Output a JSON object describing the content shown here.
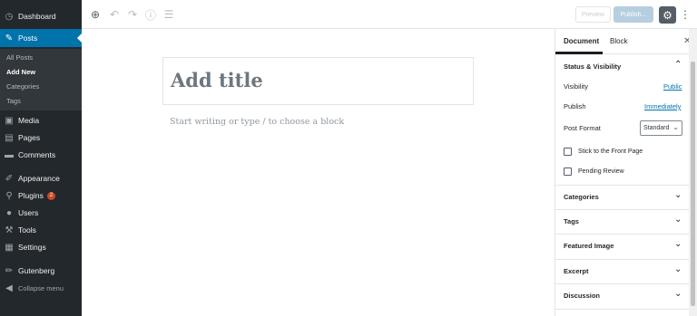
{
  "admin_menu": {
    "items": [
      {
        "label": "Dashboard",
        "icon": "dashboard-icon",
        "glyph": "◷"
      },
      {
        "label": "Posts",
        "icon": "pin-icon",
        "glyph": "✎"
      },
      {
        "label": "Media",
        "icon": "media-icon",
        "glyph": "▣"
      },
      {
        "label": "Pages",
        "icon": "pages-icon",
        "glyph": "▤"
      },
      {
        "label": "Comments",
        "icon": "comments-icon",
        "glyph": "▬"
      },
      {
        "label": "Appearance",
        "icon": "brush-icon",
        "glyph": "✐"
      },
      {
        "label": "Plugins",
        "icon": "plugin-icon",
        "glyph": "⚲",
        "badge": "2"
      },
      {
        "label": "Users",
        "icon": "users-icon",
        "glyph": "●"
      },
      {
        "label": "Tools",
        "icon": "wrench-icon",
        "glyph": "⚒"
      },
      {
        "label": "Settings",
        "icon": "settings-icon",
        "glyph": "▦"
      },
      {
        "label": "Gutenberg",
        "icon": "gutenberg-icon",
        "glyph": "✏"
      }
    ],
    "submenu": [
      "All Posts",
      "Add New",
      "Categories",
      "Tags"
    ],
    "collapse_label": "Collapse menu"
  },
  "toolbar": {
    "preview_label": "Preview",
    "publish_label": "Publish..."
  },
  "editor": {
    "title_placeholder": "Add title",
    "block_placeholder": "Start writing or type / to choose a block"
  },
  "sidebar": {
    "tabs": [
      "Document",
      "Block"
    ],
    "status_title": "Status & Visibility",
    "visibility_label": "Visibility",
    "visibility_value": "Public",
    "publish_label": "Publish",
    "publish_value": "Immediately",
    "post_format_label": "Post Format",
    "post_format_value": "Standard",
    "stick_label": "Stick to the Front Page",
    "pending_label": "Pending Review",
    "panels": [
      "Categories",
      "Tags",
      "Featured Image",
      "Excerpt",
      "Discussion"
    ]
  },
  "colors": {
    "admin_bg": "#23282d",
    "accent": "#0073aa",
    "badge": "#ca4a1f"
  }
}
